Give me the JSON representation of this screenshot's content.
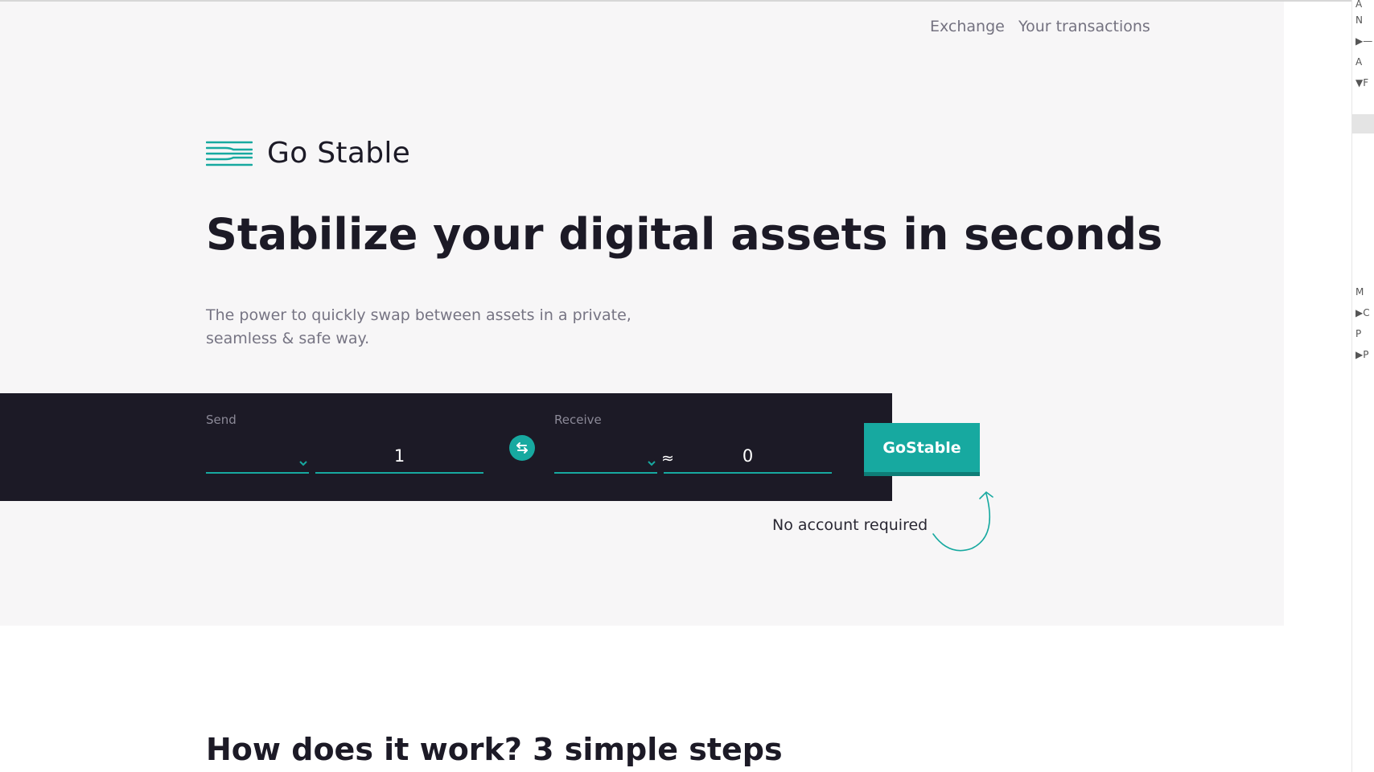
{
  "nav": {
    "exchange": "Exchange",
    "transactions": "Your transactions"
  },
  "brand": {
    "name": "Go Stable",
    "accent_color": "#17a9a0",
    "dark_color": "#1c1a26"
  },
  "hero": {
    "headline": "Stabilize your digital assets in seconds",
    "subtitle_line1": "The power to quickly swap between assets in a private,",
    "subtitle_line2": "seamless & safe way."
  },
  "swap": {
    "send_label": "Send",
    "receive_label": "Receive",
    "send_amount": "1",
    "receive_amount": "0",
    "approx_symbol": "≈",
    "submit_label": "GoStable",
    "note": "No account required",
    "swap_icon": "swap-arrows-icon",
    "chevron_icon": "chevron-down-icon"
  },
  "how": {
    "title_bold": "How does it work?",
    "title_rest": "3 simple steps"
  },
  "devtools": {
    "rows": [
      {
        "arrow": "",
        "text": "A"
      },
      {
        "arrow": "",
        "text": "N"
      },
      {
        "arrow": "▶",
        "text": "—"
      },
      {
        "arrow": "",
        "text": "A"
      },
      {
        "arrow": "▼",
        "text": "F"
      },
      {
        "arrow": "",
        "text": "M"
      },
      {
        "arrow": "▶",
        "text": "C"
      },
      {
        "arrow": "",
        "text": "P"
      },
      {
        "arrow": "▶",
        "text": "P"
      }
    ]
  }
}
